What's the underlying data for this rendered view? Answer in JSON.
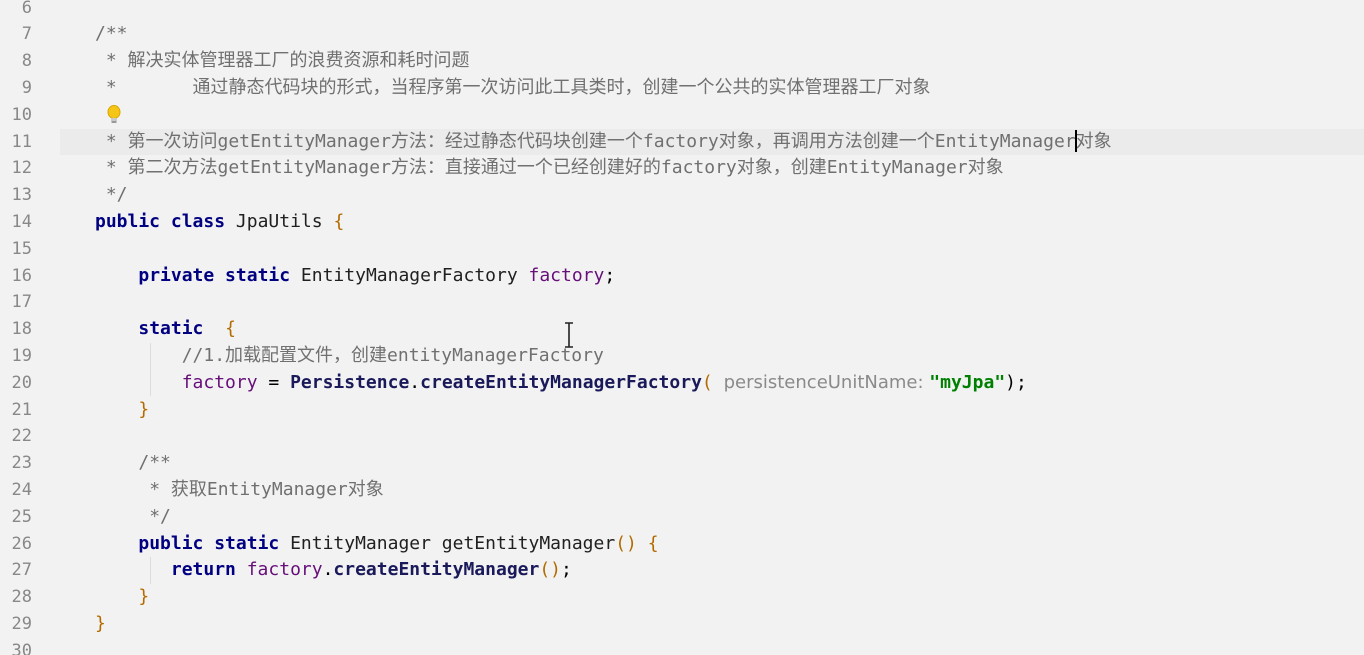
{
  "editor": {
    "lines": [
      {
        "number": "6",
        "tokens": []
      },
      {
        "number": "7",
        "tokens": [
          {
            "t": "/**",
            "c": "cmt"
          }
        ]
      },
      {
        "number": "8",
        "tokens": [
          {
            "t": " * 解决实体管理器工厂的浪费资源和耗时问题",
            "c": "cmt"
          }
        ]
      },
      {
        "number": "9",
        "tokens": [
          {
            "t": " *       通过静态代码块的形式，当程序第一次访问此工具类时，创建一个公共的实体管理器工厂对象",
            "c": "cmt"
          }
        ]
      },
      {
        "number": "10",
        "tokens": []
      },
      {
        "number": "11",
        "tokens": [
          {
            "t": " * 第一次访问getEntityManager方法：经过静态代码块创建一个factory对象，再调用方法创建一个EntityManager对象",
            "c": "cmt"
          }
        ]
      },
      {
        "number": "12",
        "tokens": [
          {
            "t": " * 第二次方法getEntityManager方法：直接通过一个已经创建好的factory对象，创建EntityManager对象",
            "c": "cmt"
          }
        ]
      },
      {
        "number": "13",
        "tokens": [
          {
            "t": " */",
            "c": "cmt"
          }
        ]
      },
      {
        "number": "14",
        "tokens": [
          {
            "t": "public class ",
            "c": "kw"
          },
          {
            "t": "JpaUtils ",
            "c": "cls"
          },
          {
            "t": "{",
            "c": "brace"
          }
        ]
      },
      {
        "number": "15",
        "tokens": []
      },
      {
        "number": "16",
        "tokens": [
          {
            "t": "    "
          },
          {
            "t": "private static ",
            "c": "kw"
          },
          {
            "t": "EntityManagerFactory ",
            "c": "cls"
          },
          {
            "t": "factory",
            "c": "fld"
          },
          {
            "t": ";",
            "c": "punct"
          }
        ]
      },
      {
        "number": "17",
        "tokens": []
      },
      {
        "number": "18",
        "tokens": [
          {
            "t": "    "
          },
          {
            "t": "static  ",
            "c": "kw"
          },
          {
            "t": "{",
            "c": "brace"
          }
        ]
      },
      {
        "number": "19",
        "tokens": [
          {
            "t": "        "
          },
          {
            "t": "//1.加载配置文件，创建entityManagerFactory",
            "c": "cmt"
          }
        ]
      },
      {
        "number": "20",
        "tokens": [
          {
            "t": "        "
          },
          {
            "t": "factory",
            "c": "fld"
          },
          {
            "t": " = ",
            "c": "punct"
          },
          {
            "t": "Persistence",
            "c": "mth"
          },
          {
            "t": ".",
            "c": "punct"
          },
          {
            "t": "createEntityManagerFactory",
            "c": "mth"
          },
          {
            "t": "( ",
            "c": "brace"
          },
          {
            "t": "persistenceUnitName: ",
            "c": "hint"
          },
          {
            "t": "\"myJpa\"",
            "c": "str"
          },
          {
            "t": ");",
            "c": "punct"
          }
        ]
      },
      {
        "number": "21",
        "tokens": [
          {
            "t": "    "
          },
          {
            "t": "}",
            "c": "brace"
          }
        ]
      },
      {
        "number": "22",
        "tokens": []
      },
      {
        "number": "23",
        "tokens": [
          {
            "t": "    "
          },
          {
            "t": "/**",
            "c": "cmt"
          }
        ]
      },
      {
        "number": "24",
        "tokens": [
          {
            "t": "    "
          },
          {
            "t": " * 获取EntityManager对象",
            "c": "cmt"
          }
        ]
      },
      {
        "number": "25",
        "tokens": [
          {
            "t": "    "
          },
          {
            "t": " */",
            "c": "cmt"
          }
        ]
      },
      {
        "number": "26",
        "tokens": [
          {
            "t": "    "
          },
          {
            "t": "public static ",
            "c": "kw"
          },
          {
            "t": "EntityManager ",
            "c": "cls"
          },
          {
            "t": "getEntityManager",
            "c": "cls"
          },
          {
            "t": "() ",
            "c": "brace"
          },
          {
            "t": "{",
            "c": "brace"
          }
        ]
      },
      {
        "number": "27",
        "tokens": [
          {
            "t": "       "
          },
          {
            "t": "return ",
            "c": "kw"
          },
          {
            "t": "factory",
            "c": "fld"
          },
          {
            "t": ".",
            "c": "punct"
          },
          {
            "t": "createEntityManager",
            "c": "mth"
          },
          {
            "t": "()",
            "c": "brace"
          },
          {
            "t": ";",
            "c": "punct"
          }
        ]
      },
      {
        "number": "28",
        "tokens": [
          {
            "t": "    "
          },
          {
            "t": "}",
            "c": "brace"
          }
        ]
      },
      {
        "number": "29",
        "tokens": [
          {
            "t": "}",
            "c": "brace"
          }
        ]
      },
      {
        "number": "30",
        "tokens": []
      }
    ],
    "active_line": "11"
  },
  "icons": {
    "bulb": "lightbulb-icon",
    "text_cursor": "text-cursor-icon"
  },
  "colors": {
    "background": "#f2f2f2",
    "keyword": "#000080",
    "comment": "#707070",
    "field": "#660e7a",
    "string": "#008000"
  }
}
